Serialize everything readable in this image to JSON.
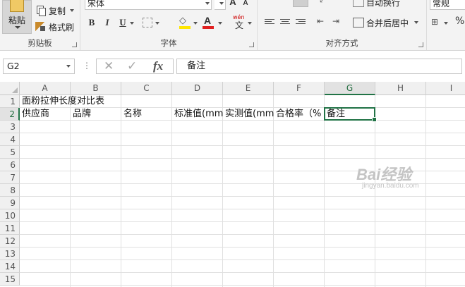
{
  "ribbon": {
    "clipboard": {
      "paste": "粘贴",
      "copy": "复制",
      "format_painter": "格式刷",
      "group_label": "剪贴板"
    },
    "font": {
      "font_name": "宋体",
      "bold": "B",
      "italic": "I",
      "underline": "U",
      "grow": "A",
      "shrink": "A",
      "wen": "wén",
      "wen_char": "文",
      "group_label": "字体",
      "highlight_color": "#ffe600",
      "font_color": "#e02020"
    },
    "alignment": {
      "wrap_text": "自动换行",
      "merge_center": "合并后居中",
      "group_label": "对齐方式"
    },
    "number": {
      "format": "常规",
      "percent": "%"
    }
  },
  "formula_bar": {
    "name_box": "G2",
    "cancel": "✕",
    "enter": "✓",
    "fx": "fx",
    "content": "备注"
  },
  "sheet": {
    "columns": [
      "A",
      "B",
      "C",
      "D",
      "E",
      "F",
      "G",
      "H",
      "I"
    ],
    "rows": [
      "1",
      "2",
      "3",
      "4",
      "5",
      "6",
      "7",
      "8",
      "9",
      "10",
      "11",
      "12",
      "13",
      "14",
      "15"
    ],
    "active_cell": "G2",
    "cells": {
      "A1": "面粉拉伸长度对比表",
      "A2": "供应商",
      "B2": "品牌",
      "C2": "名称",
      "D2": "标准值(mm",
      "E2": "实测值(mm",
      "F2": "合格率（%",
      "G2": "备注"
    }
  },
  "watermark": {
    "main": "Bai经验",
    "sub": "jingyan.baidu.com"
  },
  "colors": {
    "accent": "#217346"
  }
}
